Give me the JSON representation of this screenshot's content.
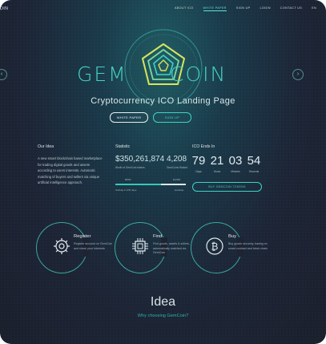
{
  "header": {
    "brand": "OIN",
    "nav": [
      "ABOUT ICO",
      "WHITE PAPER",
      "SIGN UP",
      "LOGIN",
      "CONTACT US",
      "EN"
    ],
    "active_nav": "WHITE PAPER"
  },
  "hero": {
    "logo_left": "GEM",
    "logo_right": "COIN",
    "headline": "Cryptocurrency ICO Landing Page",
    "white_paper_button": "WHITE PAPER",
    "sign_up_button": "SIGN UP"
  },
  "idea_col": {
    "title": "Our Idea",
    "text": "A new smart blockchain based marketplace for trading digital goods and assets according to users interests. Automatic matching of buyers and sellers via unique artificial intelligence approach."
  },
  "statistic": {
    "title": "Statistic",
    "worth_value": "$350,261,874",
    "worth_caption": "Worth of GemCoin tokens",
    "minted_value": "4,208",
    "minted_caption": "GemCoins Raised",
    "progress_left_label": "$50M",
    "progress_right_label": "$125M",
    "progress_fraction": 0.65,
    "bottom_left": "Softcap in 678 days",
    "bottom_right": "Hardcap"
  },
  "ico": {
    "title": "ICO Ends In",
    "countdown": [
      {
        "value": "79",
        "label": "Days"
      },
      {
        "value": "21",
        "label": "Hours"
      },
      {
        "value": "03",
        "label": "Minutes"
      },
      {
        "value": "54",
        "label": "Seconds"
      }
    ],
    "buy_button": "BUY GEMCOIN TOKENS"
  },
  "features": [
    {
      "title": "Register",
      "text": "Register account on GemCoin and share your Interests",
      "icon": "gear-icon"
    },
    {
      "title": "Find",
      "text": "Find goods, assets & sellers, automatically matched via GemCoin",
      "icon": "chip-icon"
    },
    {
      "title": "Buy",
      "text": "Buy goods securely, basing on smart contract and block chain",
      "icon": "bitcoin-icon"
    }
  ],
  "idea_section": {
    "title": "Idea",
    "subtitle": "Why choosing GemCoin?"
  },
  "colors": {
    "accent": "#3fd2c2",
    "background": "#1b1f2c"
  }
}
